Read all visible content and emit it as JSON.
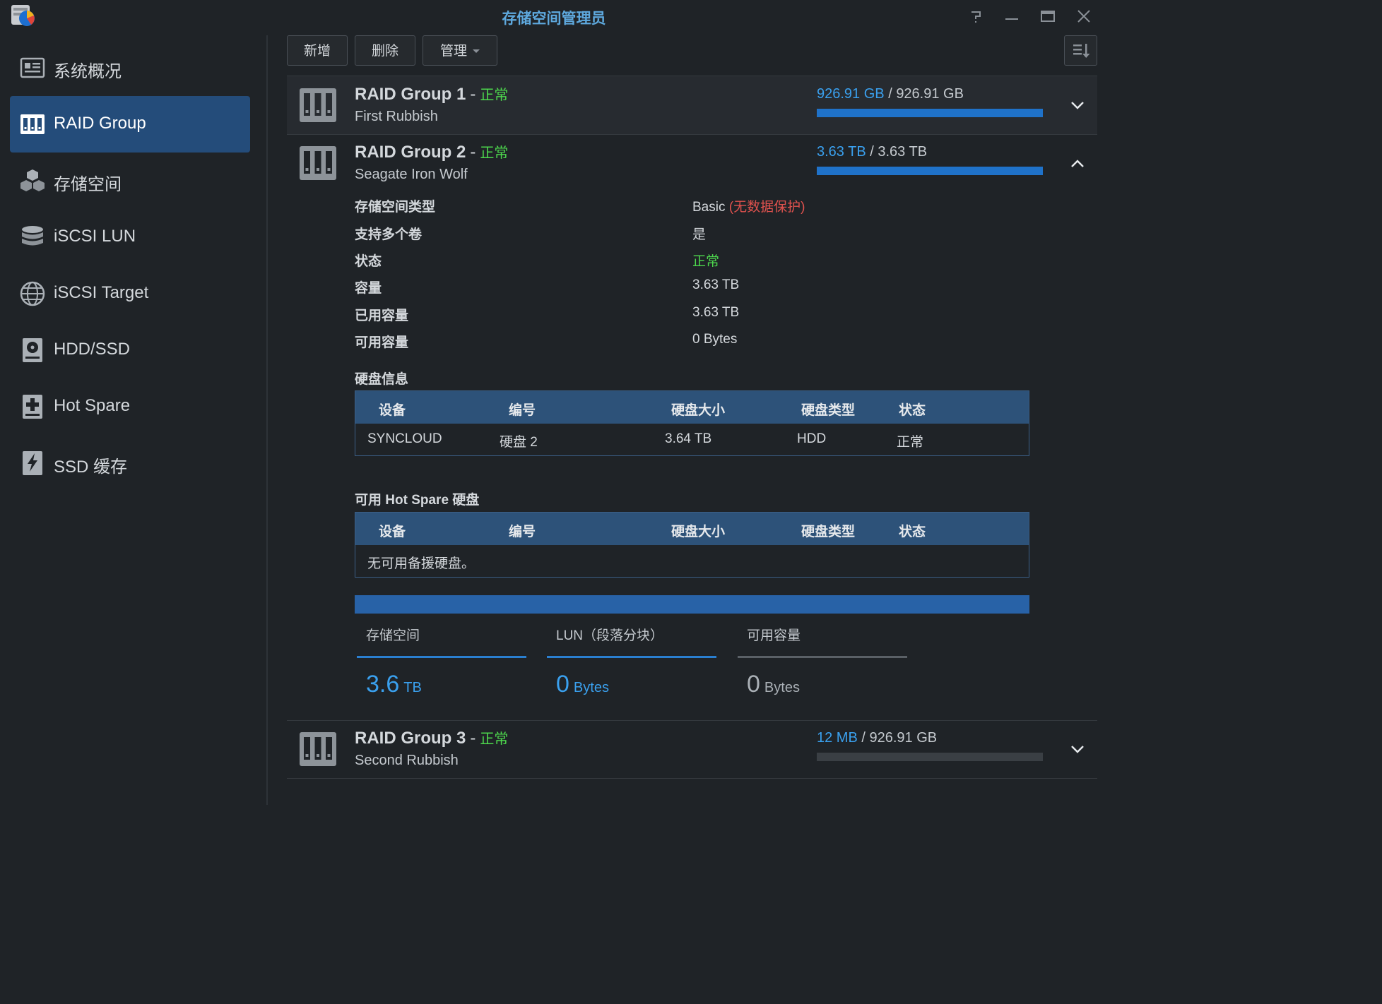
{
  "window": {
    "title": "存储空间管理员",
    "help_icon": "help-icon",
    "minimize_icon": "minimize-icon",
    "maximize_icon": "maximize-icon",
    "close_icon": "close-icon"
  },
  "sidebar": {
    "items": [
      {
        "label": "系统概况",
        "icon": "overview-icon",
        "active": false
      },
      {
        "label": "RAID Group",
        "icon": "raid-group-icon",
        "active": true
      },
      {
        "label": "存储空间",
        "icon": "cubes-icon",
        "active": false
      },
      {
        "label": "iSCSI LUN",
        "icon": "database-icon",
        "active": false
      },
      {
        "label": "iSCSI Target",
        "icon": "globe-icon",
        "active": false
      },
      {
        "label": "HDD/SSD",
        "icon": "hdd-icon",
        "active": false
      },
      {
        "label": "Hot Spare",
        "icon": "hot-spare-icon",
        "active": false
      },
      {
        "label": "SSD 缓存",
        "icon": "ssd-cache-icon",
        "active": false
      }
    ]
  },
  "toolbar": {
    "create_label": "新增",
    "delete_label": "删除",
    "manage_label": "管理",
    "sort_icon": "sort-icon"
  },
  "colors": {
    "accent_blue": "#3aa0ee",
    "status_green": "#4dd84d",
    "warning_red": "#e0524e",
    "active_nav": "#244c7a"
  },
  "groups": [
    {
      "name": "RAID Group 1",
      "dash": "-",
      "status": "正常",
      "description": "First Rubbish",
      "used": "926.91 GB",
      "slash": "/",
      "total": "926.91 GB",
      "fill": 1.0,
      "expanded": false
    },
    {
      "name": "RAID Group 2",
      "dash": "-",
      "status": "正常",
      "description": "Seagate Iron Wolf",
      "used": "3.63 TB",
      "slash": "/",
      "total": "3.63 TB",
      "fill": 1.0,
      "expanded": true
    },
    {
      "name": "RAID Group 3",
      "dash": "-",
      "status": "正常",
      "description": "Second Rubbish",
      "used": "12 MB",
      "slash": "/",
      "total": "926.91 GB",
      "fill": 0.0,
      "expanded": false
    }
  ],
  "details": {
    "props": [
      {
        "label": "存储空间类型",
        "value": "Basic",
        "note": "(无数据保护)"
      },
      {
        "label": "支持多个卷",
        "value": "是"
      },
      {
        "label": "状态",
        "value": "正常"
      },
      {
        "label": "容量",
        "value": "3.63 TB"
      },
      {
        "label": "已用容量",
        "value": "3.63 TB"
      },
      {
        "label": "可用容量",
        "value": "0 Bytes"
      }
    ],
    "disk_info_title": "硬盘信息",
    "disk_table": {
      "headers": [
        "设备",
        "编号",
        "硬盘大小",
        "硬盘类型",
        "状态"
      ],
      "rows": [
        [
          "SYNCLOUD",
          "硬盘 2",
          "3.64 TB",
          "HDD",
          "正常"
        ]
      ]
    },
    "hot_spare_title": "可用 Hot Spare 硬盘",
    "hot_spare_table": {
      "headers": [
        "设备",
        "编号",
        "硬盘大小",
        "硬盘类型",
        "状态"
      ],
      "empty_text": "无可用备援硬盘。"
    },
    "stats": [
      {
        "label": "存储空间",
        "value": "3.6",
        "unit": "TB"
      },
      {
        "label": "LUN（段落分块）",
        "value": "0",
        "unit": "Bytes"
      },
      {
        "label": "可用容量",
        "value": "0",
        "unit": "Bytes"
      }
    ]
  }
}
